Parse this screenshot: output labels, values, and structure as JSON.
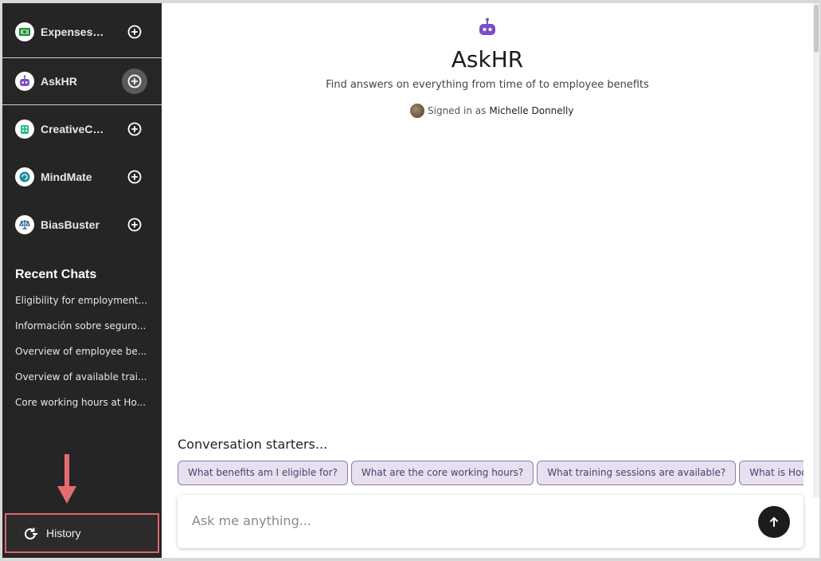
{
  "sidebar": {
    "bots": [
      {
        "name": "ExpensesE...",
        "icon": "money-icon",
        "active": false
      },
      {
        "name": "AskHR",
        "icon": "robot-icon",
        "active": true
      },
      {
        "name": "CreativeCh...",
        "icon": "building-icon",
        "active": false
      },
      {
        "name": "MindMate",
        "icon": "brain-icon",
        "active": false
      },
      {
        "name": "BiasBuster",
        "icon": "scales-icon",
        "active": false
      }
    ],
    "recent_title": "Recent Chats",
    "recent": [
      "Eligibility for employment...",
      "Información sobre seguro...",
      "Overview of employee be...",
      "Overview of available trai...",
      "Core working hours at Ho..."
    ],
    "history_label": "History"
  },
  "main": {
    "title": "AskHR",
    "subtitle": "Find answers on everything from time of to employee benefits",
    "signed_in_prefix": "Signed in as",
    "user_name": "Michelle Donnelly",
    "starters_title": "Conversation starters...",
    "starters": [
      "What benefits am I eligible for?",
      "What are the core working hours?",
      "What training sessions are available?",
      "What is Hooray's remote work policy?"
    ],
    "input_placeholder": "Ask me anything..."
  },
  "colors": {
    "sidebar_bg": "#252525",
    "accent_purple": "#7b4fc4",
    "chip_bg": "#e8e0f0",
    "chip_border": "#8f7ba6",
    "highlight_red": "#d9676b"
  }
}
